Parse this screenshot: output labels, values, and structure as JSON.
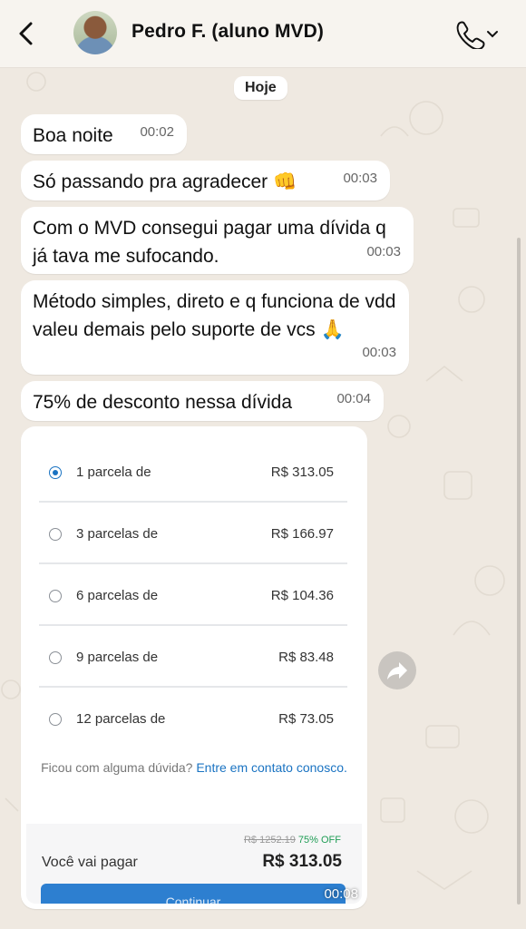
{
  "header": {
    "contact_name": "Pedro F. (aluno MVD)",
    "back_icon": "chevron-left-icon",
    "call_icon": "phone-icon",
    "call_menu_icon": "chevron-down-icon"
  },
  "date_chip": "Hoje",
  "messages": [
    {
      "text": "Boa noite",
      "time": "00:02"
    },
    {
      "text": "Só passando pra agradecer 👊",
      "time": "00:03"
    },
    {
      "text": "Com o MVD consegui pagar uma dívida q já tava me sufocando.",
      "time": "00:03"
    },
    {
      "text": "Método simples, direto e q funciona de vdd valeu demais pelo suporte de vcs 🙏",
      "time": "00:03"
    },
    {
      "text": "75% de desconto nessa dívida",
      "time": "00:04"
    }
  ],
  "image_message": {
    "time": "00:08",
    "options": [
      {
        "label": "1 parcela de",
        "price": "R$ 313.05",
        "selected": true
      },
      {
        "label": "3 parcelas de",
        "price": "R$ 166.97",
        "selected": false
      },
      {
        "label": "6 parcelas de",
        "price": "R$ 104.36",
        "selected": false
      },
      {
        "label": "9 parcelas de",
        "price": "R$ 83.48",
        "selected": false
      },
      {
        "label": "12 parcelas de",
        "price": "R$ 73.05",
        "selected": false
      }
    ],
    "help_text": "Ficou com alguma dúvida?",
    "help_link": "Entre em contato conosco.",
    "old_price": "R$ 1252.19",
    "discount": "75% OFF",
    "pay_label": "Você vai pagar",
    "pay_total": "R$ 313.05",
    "continue_label": "Continuar"
  },
  "colors": {
    "background": "#efe9e1",
    "bubble": "#ffffff",
    "accent": "#1a73c2",
    "discount": "#1f9d55"
  }
}
